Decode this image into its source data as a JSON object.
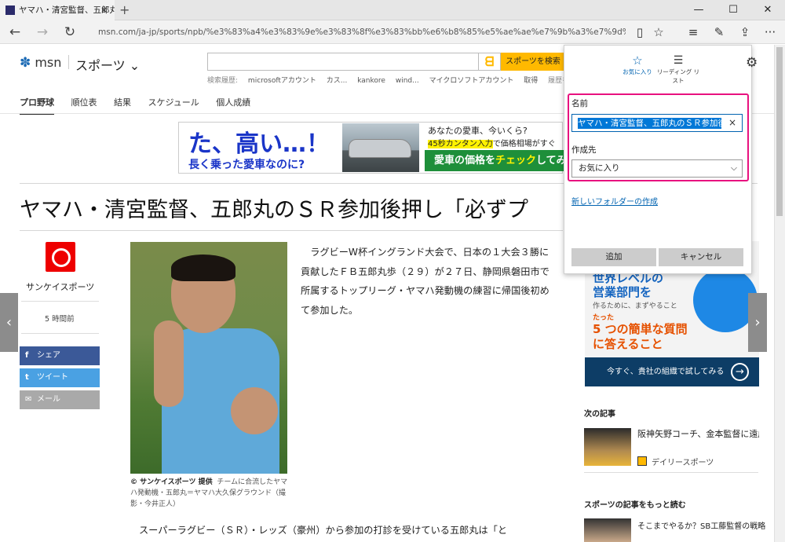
{
  "browser": {
    "tab_title": "ヤマハ・清宮監督、五郎丸の",
    "tab_close": "×",
    "new_tab": "+",
    "url": "msn.com/ja-jp/sports/npb/%e3%83%a4%e3%83%9e%e3%83%8f%e3%83%bb%e6%b8%85%e5%ae%ae%e7%9b%a3%e7%9d%a3%e3%80%81%e4%ba%94%",
    "icons": {
      "back": "←",
      "forward": "→",
      "refresh": "↻",
      "reading_view": "▯",
      "favorite": "☆",
      "hub": "≡",
      "note": "✎",
      "share": "⇪",
      "more": "···",
      "minimize": "—",
      "maximize": "☐",
      "close": "✕"
    }
  },
  "msn": {
    "logo": "msn",
    "section": "スポーツ ⌄",
    "search_button": "スポーツを検索",
    "history_label": "検索履歴:",
    "history_items": [
      "microsoftアカウント",
      "カス...",
      "kankore",
      "wind...",
      "マイクロソフトアカウント",
      "取得",
      "履歴を管"
    ],
    "subnav": [
      "プロ野球",
      "順位表",
      "結果",
      "スケジュール",
      "個人成績"
    ]
  },
  "ad": {
    "big": "た、高い…！",
    "sub": "長く乗った愛車なのに?",
    "q1": "あなたの愛車、今いくら?",
    "q2_highlight": "45秒カンタン入力",
    "q2_rest": "で価格相場がすぐ",
    "green_a": "愛車の価格を",
    "green_b": "チェック",
    "green_c": "してみ"
  },
  "article": {
    "headline": "ヤマハ・清宮監督、五郎丸のＳＲ参加後押し「必ずプ",
    "source": "サンケイスポーツ",
    "time": "5 時間前",
    "share_buttons": [
      "シェア",
      "ツイート",
      "メール"
    ],
    "share_icons": [
      "f",
      "t",
      "✉"
    ],
    "caption_credit": "© サンケイスポーツ 提供",
    "caption": "チームに合流したヤマハ発動機・五郎丸＝ヤマハ大久保グラウンド（撮影・今井正人）",
    "paragraph1": "ラグビーW杯イングランド大会で、日本の１大会３勝に貢献したＦＢ五郎丸歩（２９）が２７日、静岡県磐田市で所属するトップリーグ・ヤマハ発動機の練習に帰国後初めて参加した。",
    "paragraph2": "スーパーラグビー（ＳＲ）・レッズ（豪州）から参加の打診を受けている五郎丸は「と"
  },
  "right_ad": {
    "line1": "世界レベルの",
    "line2": "営業部門を",
    "line3": "作るために、まずやること",
    "line4": "たった",
    "line5": "5 つの簡単な質問",
    "line6": "に答えること",
    "bar": "今すぐ、貴社の組織で試してみる",
    "bar_icon": "→"
  },
  "next": {
    "header": "次の記事",
    "item_title": "阪神矢野コーチ、金本監督に遠慮なし",
    "item_source": "デイリースポーツ"
  },
  "more": {
    "header": "スポーツの記事をもっと読む",
    "item_title": "そこまでやるか？SB工藤監督の戦略"
  },
  "carousel": {
    "left": "‹",
    "right": "›"
  },
  "favorites_panel": {
    "tab_favorites": "お気に入り",
    "tab_reading_list": "リーディング リスト",
    "name_label": "名前",
    "name_value": "ヤマハ・清宮監督、五郎丸のＳＲ参加後",
    "clear": "×",
    "folder_label": "作成先",
    "folder_value": "お気に入り",
    "new_folder_link": "新しいフォルダーの作成",
    "add_button": "追加",
    "cancel_button": "キャンセル"
  },
  "colors": {
    "accent": "#0078d7",
    "highlight_border": "#e8117f",
    "search_button": "#ffb900"
  }
}
